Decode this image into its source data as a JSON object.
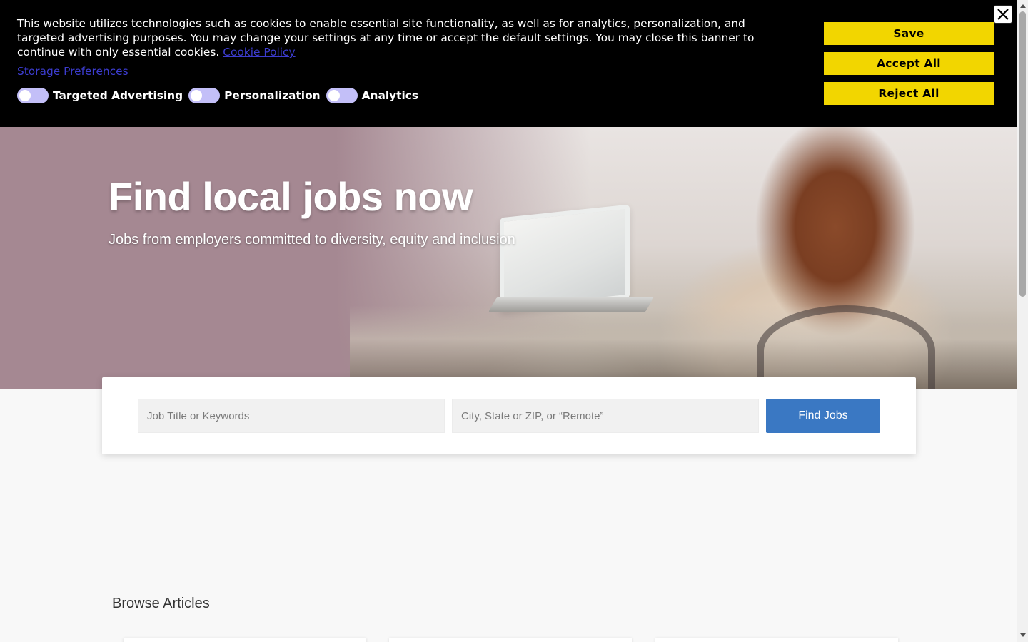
{
  "cookie_banner": {
    "text": "This website utilizes technologies such as cookies to enable essential site functionality, as well as for analytics, personalization, and targeted advertising purposes. You may change your settings at any time or accept the default settings. You may close this banner to continue with only essential cookies.",
    "cookie_policy_link": "Cookie Policy",
    "storage_preferences_link": "Storage Preferences",
    "toggles": [
      {
        "label": "Targeted Advertising",
        "on": false
      },
      {
        "label": "Personalization",
        "on": false
      },
      {
        "label": "Analytics",
        "on": false
      }
    ],
    "buttons": {
      "save": "Save",
      "accept_all": "Accept All",
      "reject_all": "Reject All"
    },
    "close_icon": "close-icon",
    "colors": {
      "background": "#000000",
      "button": "#f2d600",
      "link": "#3c3ccf",
      "toggle": "#c3bff8"
    }
  },
  "hero": {
    "title": "Find local jobs now",
    "subtitle": "Jobs from employers committed to diversity, equity and inclusion"
  },
  "search": {
    "keywords_placeholder": "Job Title or Keywords",
    "location_placeholder": "City, State or ZIP, or “Remote”",
    "button_label": "Find Jobs",
    "button_color": "#3a78c3"
  },
  "browse": {
    "heading": "Browse Articles"
  }
}
